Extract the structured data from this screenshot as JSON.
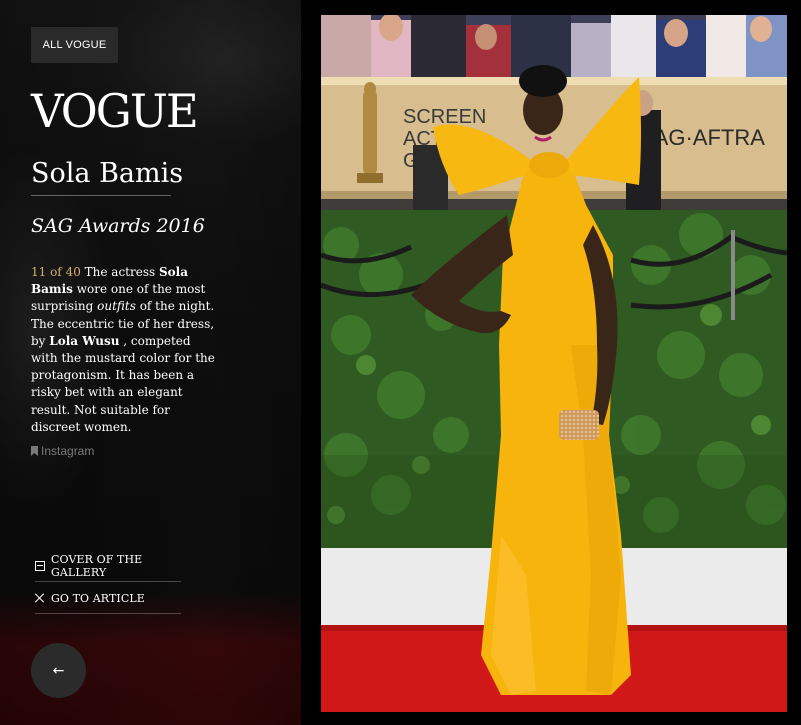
{
  "nav": {
    "all_label": "ALL VOGUE"
  },
  "brand": {
    "logo": "VOGUE"
  },
  "slide": {
    "person": "Sola Bamis",
    "event": "SAG Awards 2016",
    "counter": "11 of 40",
    "desc_1": " The actress ",
    "name_bold": "Sola Bamis",
    "desc_2": " wore one of the most surprising ",
    "outfits_italic": "outfits",
    "desc_3": " of the night. The eccentric tie of her dress, by ",
    "designer_bold": "Lola Wusu",
    "desc_4": " , competed with the mustard color for the protagonism. It has been a risky bet with an elegant result. Not suitable for discreet women.",
    "instagram_label": "Instagram"
  },
  "links": {
    "cover": "COVER OF THE GALLERY",
    "article": "GO TO ARTICLE"
  },
  "controls": {
    "back_arrow": "←"
  },
  "photo": {
    "backdrop_text_1": "SCREEN",
    "backdrop_text_2": "ACTORS",
    "backdrop_text_3": "GUILD",
    "backdrop_text_right": "SAG·AFTRA"
  },
  "colors": {
    "dress": "#f6b40c",
    "carpet": "#d11a1a",
    "counter": "#d8b26a"
  },
  "icons": [
    "bookmark-icon",
    "gallery-cover-icon",
    "close-icon",
    "arrow-left-icon"
  ]
}
